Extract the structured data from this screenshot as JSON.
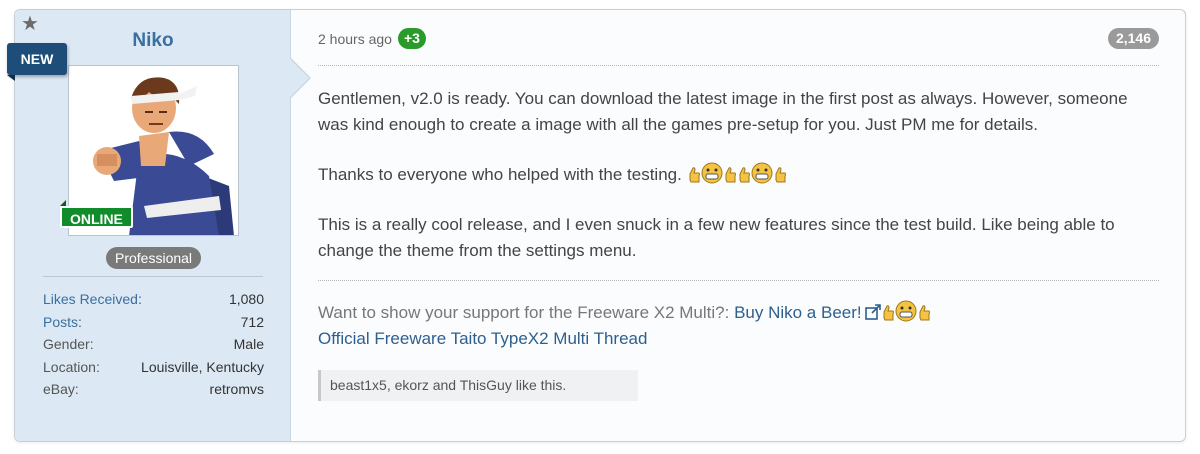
{
  "user": {
    "name": "Niko",
    "new_label": "NEW",
    "online_label": "ONLINE",
    "title": "Professional",
    "stats": [
      {
        "key": "Likes Received",
        "value": "1,080",
        "link": true
      },
      {
        "key": "Posts",
        "value": "712",
        "link": true
      },
      {
        "key": "Gender",
        "value": "Male",
        "link": false
      },
      {
        "key": "Location",
        "value": "Louisville, Kentucky",
        "link": false
      },
      {
        "key": "eBay",
        "value": "retromvs",
        "link": false
      }
    ]
  },
  "post": {
    "time": "2 hours ago",
    "reaction_badge": "+3",
    "post_number": "2,146",
    "paragraph1": "Gentlemen, v2.0 is ready. You can download the latest image in the first post as always. However, someone was kind enough to create a image with all the games pre-setup for you. Just PM me for details.",
    "paragraph2": "Thanks to everyone who helped with the testing.",
    "paragraph3": "This is a really cool release, and I even snuck in a few new features since the test build. Like being able to change the theme from the settings menu."
  },
  "signature": {
    "text": "Want to show your support for the Freeware X2 Multi?: ",
    "beer_link": "Buy Niko a Beer!",
    "thread_link": "Official Freeware Taito TypeX2 Multi Thread"
  },
  "likes_text": "beast1x5, ekorz and ThisGuy like this.",
  "colors": {
    "user_panel_bg": "#dce9f5",
    "link": "#3a6f9e",
    "new_ribbon": "#1f4d7a",
    "online_badge": "#118c2a",
    "plus_badge": "#2a9b2a"
  }
}
